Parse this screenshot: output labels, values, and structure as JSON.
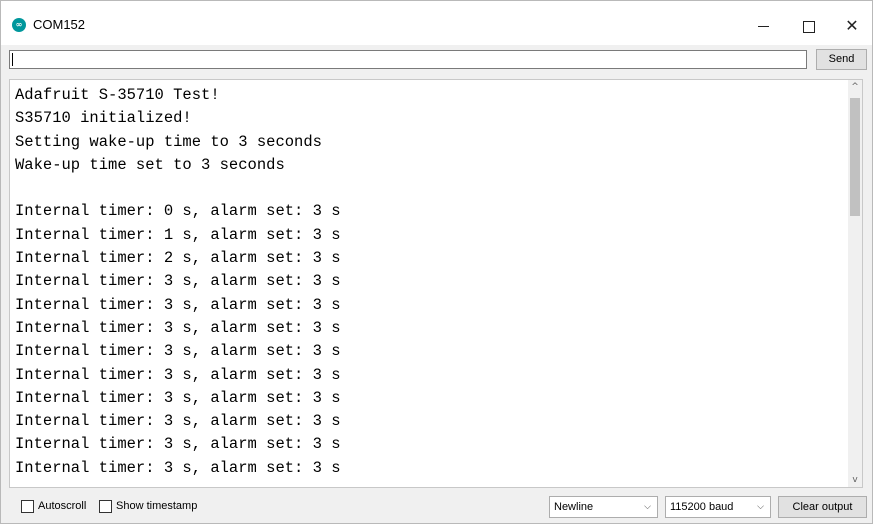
{
  "window": {
    "title": "COM152",
    "icon": "arduino-icon",
    "min_icon": "minimize-icon",
    "max_icon": "maximize-icon",
    "close_icon": "close-icon",
    "close_glyph": "✕"
  },
  "input": {
    "value": "",
    "send_label": "Send"
  },
  "output": {
    "lines": [
      "Adafruit S-35710 Test!",
      "S35710 initialized!",
      "Setting wake-up time to 3 seconds",
      "Wake-up time set to 3 seconds",
      "",
      "Internal timer: 0 s, alarm set: 3 s",
      "Internal timer: 1 s, alarm set: 3 s",
      "Internal timer: 2 s, alarm set: 3 s",
      "Internal timer: 3 s, alarm set: 3 s",
      "Internal timer: 3 s, alarm set: 3 s",
      "Internal timer: 3 s, alarm set: 3 s",
      "Internal timer: 3 s, alarm set: 3 s",
      "Internal timer: 3 s, alarm set: 3 s",
      "Internal timer: 3 s, alarm set: 3 s",
      "Internal timer: 3 s, alarm set: 3 s",
      "Internal timer: 3 s, alarm set: 3 s",
      "Internal timer: 3 s, alarm set: 3 s"
    ],
    "scroll_up_glyph": "^",
    "scroll_down_glyph": "v"
  },
  "bottom": {
    "autoscroll_label": "Autoscroll",
    "autoscroll_checked": false,
    "timestamp_label": "Show timestamp",
    "timestamp_checked": false,
    "line_ending": "Newline",
    "baud": "115200 baud",
    "clear_label": "Clear output",
    "chevron_glyph": "⌵"
  }
}
